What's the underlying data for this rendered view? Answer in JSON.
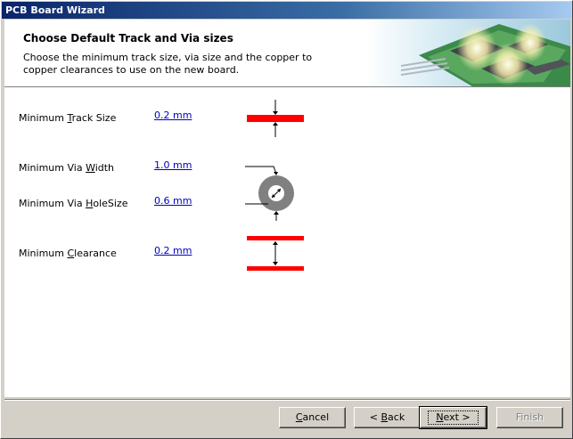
{
  "window": {
    "title": "PCB Board Wizard"
  },
  "header": {
    "title": "Choose Default Track and Via sizes",
    "subtitle": "Choose the minimum track size, via size and the copper to copper clearances to use on the new board."
  },
  "rows": [
    {
      "label_pre": "Minimum ",
      "label_key": "T",
      "label_post": "rack Size",
      "value": "0.2 mm"
    },
    {
      "label_pre": "Minimum Via ",
      "label_key": "W",
      "label_post": "idth",
      "value": "1.0 mm"
    },
    {
      "label_pre": "Minimum Via ",
      "label_key": "H",
      "label_post": "oleSize",
      "value": "0.6 mm"
    },
    {
      "label_pre": "Minimum ",
      "label_key": "C",
      "label_post": "learance",
      "value": "0.2 mm"
    }
  ],
  "buttons": {
    "cancel_pre": "",
    "cancel_key": "C",
    "cancel_post": "ancel",
    "back_pre": "< ",
    "back_key": "B",
    "back_post": "ack",
    "next_pre": "",
    "next_key": "N",
    "next_post": "ext >",
    "finish": "Finish"
  },
  "colors": {
    "track": "#ff0000",
    "via": "#808080",
    "link": "#0000c0"
  }
}
